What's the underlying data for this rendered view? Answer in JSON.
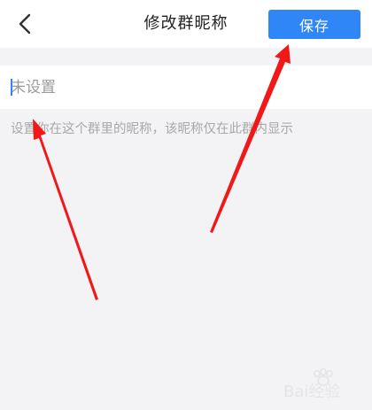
{
  "header": {
    "title": "修改群昵称",
    "save_label": "保存"
  },
  "nickname": {
    "value": "",
    "placeholder": "未设置"
  },
  "hint": "设置你在这个群里的昵称，该昵称仅在此群内显示",
  "watermark": "Bai经验",
  "colors": {
    "accent": "#2f86f6",
    "annotation_arrow": "#f01818",
    "background": "#f3f3f5"
  },
  "icons": {
    "back": "chevron-left-icon"
  }
}
